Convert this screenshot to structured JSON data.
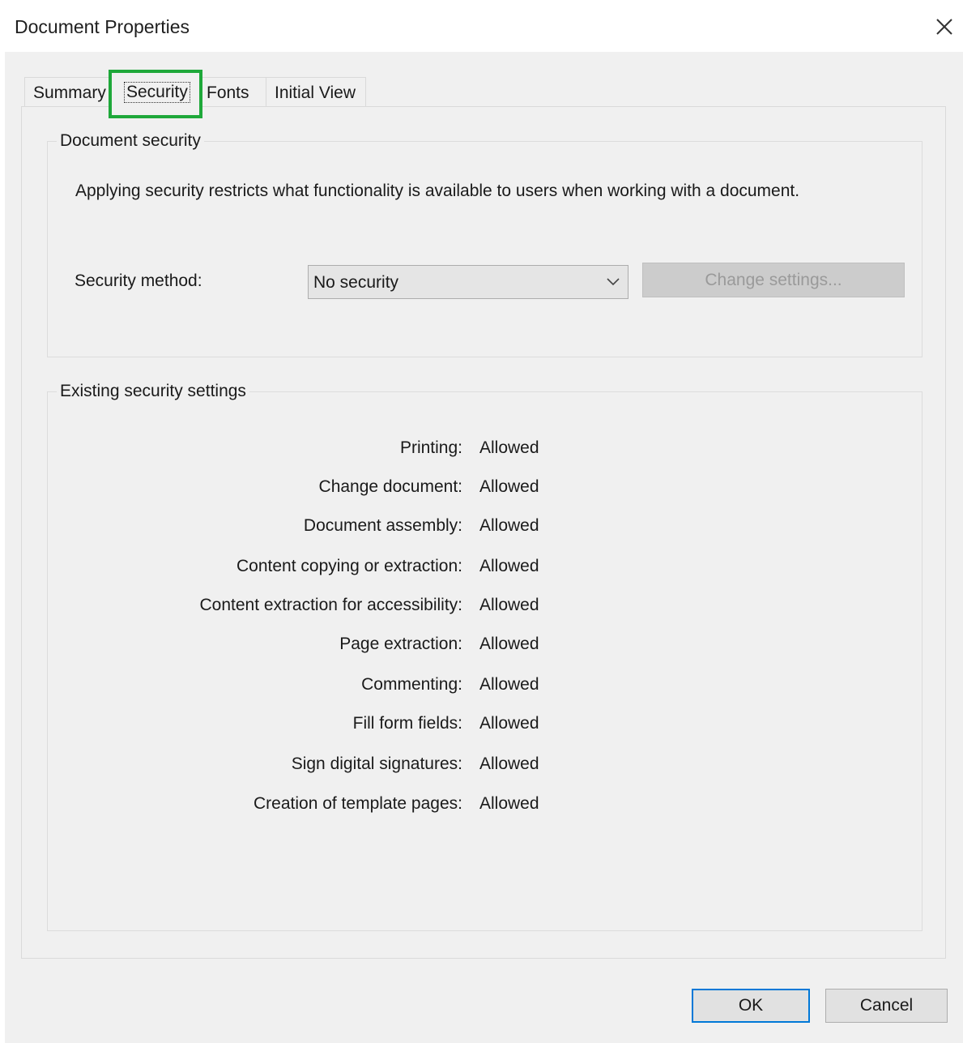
{
  "window": {
    "title": "Document Properties",
    "close_glyph": "close-icon"
  },
  "tabs": [
    {
      "label": "Summary"
    },
    {
      "label": "Security",
      "selected": true
    },
    {
      "label": "Fonts"
    },
    {
      "label": "Initial View"
    }
  ],
  "document_security": {
    "group_label": "Document security",
    "description": "Applying security restricts what functionality is available to users when working with a document.",
    "method_label": "Security method:",
    "method_value": "No security",
    "change_settings_label": "Change settings..."
  },
  "existing_settings": {
    "group_label": "Existing security settings",
    "rows": [
      {
        "label": "Printing:",
        "value": "Allowed"
      },
      {
        "label": "Change document:",
        "value": "Allowed"
      },
      {
        "label": "Document assembly:",
        "value": "Allowed"
      },
      {
        "label": "Content copying or extraction:",
        "value": "Allowed"
      },
      {
        "label": "Content extraction for accessibility:",
        "value": "Allowed"
      },
      {
        "label": "Page extraction:",
        "value": "Allowed"
      },
      {
        "label": "Commenting:",
        "value": "Allowed"
      },
      {
        "label": "Fill form fields:",
        "value": "Allowed"
      },
      {
        "label": "Sign digital signatures:",
        "value": "Allowed"
      },
      {
        "label": "Creation of template pages:",
        "value": "Allowed"
      }
    ]
  },
  "buttons": {
    "ok": "OK",
    "cancel": "Cancel"
  },
  "colors": {
    "highlight": "#1ea83a",
    "accent": "#0078d7",
    "dialog_bg": "#f0f0f0"
  }
}
